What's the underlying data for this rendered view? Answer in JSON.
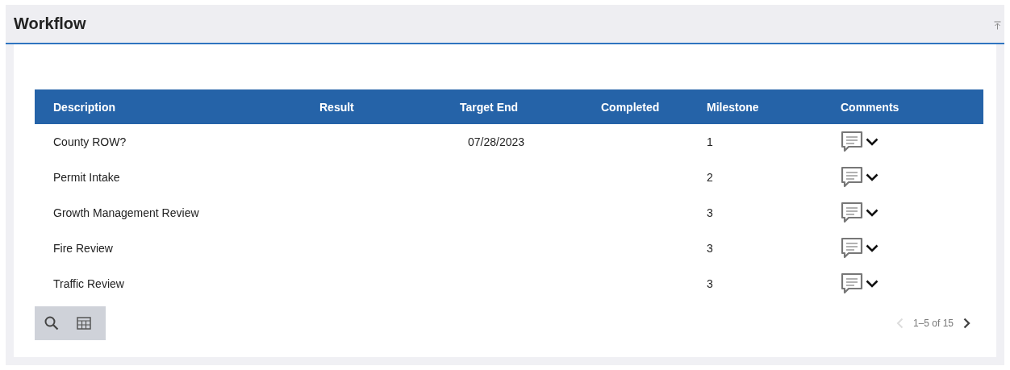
{
  "panel": {
    "title": "Workflow"
  },
  "table": {
    "columns": [
      "Description",
      "Result",
      "Target End",
      "Completed",
      "Milestone",
      "Comments"
    ],
    "rows": [
      {
        "description": "County ROW?",
        "target_end": "07/28/2023",
        "milestone": "1"
      },
      {
        "description": "Permit Intake",
        "milestone": "2"
      },
      {
        "description": "Growth Management Review",
        "milestone": "3"
      },
      {
        "description": "Fire Review",
        "milestone": "3"
      },
      {
        "description": "Traffic Review",
        "milestone": "3"
      }
    ]
  },
  "pagination": {
    "range": "1–5 of 15",
    "previous": {
      "disabled": true
    },
    "next": {
      "disabled": false
    }
  }
}
